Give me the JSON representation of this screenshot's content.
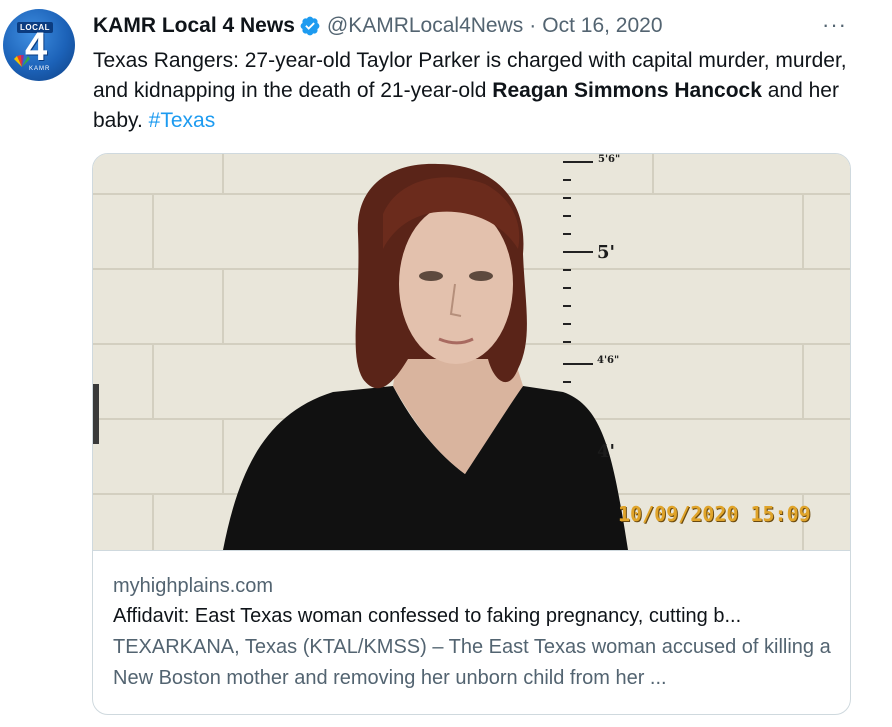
{
  "tweet": {
    "author_name": "KAMR Local 4 News",
    "handle": "@KAMRLocal4News",
    "separator": "·",
    "date": "Oct 16, 2020",
    "more_label": "···",
    "text_part1": "Texas Rangers: 27-year-old Taylor Parker is charged with capital murder, murder, and kidnapping in the death of 21-year-old ",
    "text_bold": "Reagan Simmons Hancock",
    "text_part2": " and her baby. ",
    "hashtag": "#Texas"
  },
  "avatar": {
    "local": "LOCAL",
    "number": "4",
    "station": "KAMR"
  },
  "card": {
    "photo_timestamp": "10/09/2020 15:09",
    "ruler_top": "5'6\"",
    "ruler_mid": "5'",
    "ruler_low": "4'6\"",
    "ruler_bottom": "4'",
    "domain": "myhighplains.com",
    "title": "Affidavit: East Texas woman confessed to faking pregnancy, cutting b...",
    "description": "TEXARKANA, Texas (KTAL/KMSS) – The East Texas woman accused of killing a New Boston mother and removing her unborn child from her ..."
  },
  "colors": {
    "link": "#1d9bf0",
    "verified": "#1d9bf0",
    "secondary_text": "#536471",
    "border": "#cfd9de"
  },
  "icons": [
    "verified-badge-icon",
    "more-options-icon"
  ]
}
